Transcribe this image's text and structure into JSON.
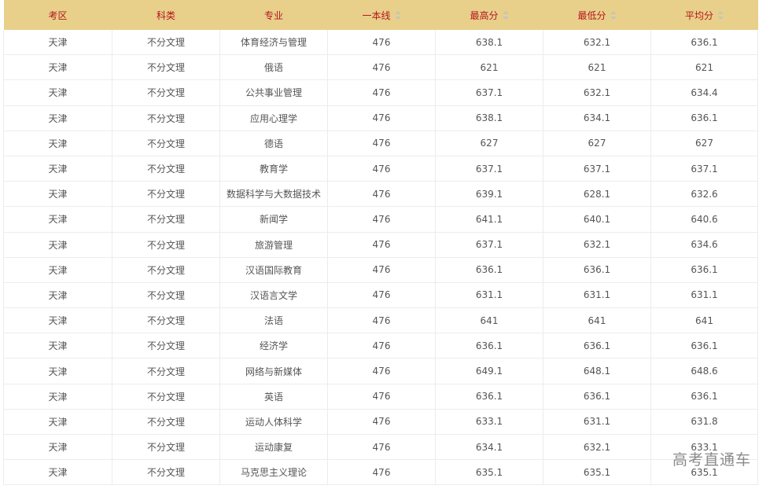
{
  "table": {
    "columns": [
      "考区",
      "科类",
      "专业",
      "一本线",
      "最高分",
      "最低分",
      "平均分"
    ],
    "sortable": [
      false,
      false,
      false,
      true,
      true,
      true,
      true
    ],
    "rows": [
      [
        "天津",
        "不分文理",
        "体育经济与管理",
        "476",
        "638.1",
        "632.1",
        "636.1"
      ],
      [
        "天津",
        "不分文理",
        "俄语",
        "476",
        "621",
        "621",
        "621"
      ],
      [
        "天津",
        "不分文理",
        "公共事业管理",
        "476",
        "637.1",
        "632.1",
        "634.4"
      ],
      [
        "天津",
        "不分文理",
        "应用心理学",
        "476",
        "638.1",
        "634.1",
        "636.1"
      ],
      [
        "天津",
        "不分文理",
        "德语",
        "476",
        "627",
        "627",
        "627"
      ],
      [
        "天津",
        "不分文理",
        "教育学",
        "476",
        "637.1",
        "637.1",
        "637.1"
      ],
      [
        "天津",
        "不分文理",
        "数据科学与大数据技术",
        "476",
        "639.1",
        "628.1",
        "632.6"
      ],
      [
        "天津",
        "不分文理",
        "新闻学",
        "476",
        "641.1",
        "640.1",
        "640.6"
      ],
      [
        "天津",
        "不分文理",
        "旅游管理",
        "476",
        "637.1",
        "632.1",
        "634.6"
      ],
      [
        "天津",
        "不分文理",
        "汉语国际教育",
        "476",
        "636.1",
        "636.1",
        "636.1"
      ],
      [
        "天津",
        "不分文理",
        "汉语言文学",
        "476",
        "631.1",
        "631.1",
        "631.1"
      ],
      [
        "天津",
        "不分文理",
        "法语",
        "476",
        "641",
        "641",
        "641"
      ],
      [
        "天津",
        "不分文理",
        "经济学",
        "476",
        "636.1",
        "636.1",
        "636.1"
      ],
      [
        "天津",
        "不分文理",
        "网络与新媒体",
        "476",
        "649.1",
        "648.1",
        "648.6"
      ],
      [
        "天津",
        "不分文理",
        "英语",
        "476",
        "636.1",
        "636.1",
        "636.1"
      ],
      [
        "天津",
        "不分文理",
        "运动人体科学",
        "476",
        "633.1",
        "631.1",
        "631.8"
      ],
      [
        "天津",
        "不分文理",
        "运动康复",
        "476",
        "634.1",
        "632.1",
        "633.1"
      ],
      [
        "天津",
        "不分文理",
        "马克思主义理论",
        "476",
        "635.1",
        "635.1",
        "635.1"
      ]
    ]
  },
  "watermark": "高考直通车",
  "colors": {
    "header_bg": "#e8d08a",
    "header_text": "#b5141e",
    "cell_text": "#555555",
    "border": "#ececec"
  }
}
